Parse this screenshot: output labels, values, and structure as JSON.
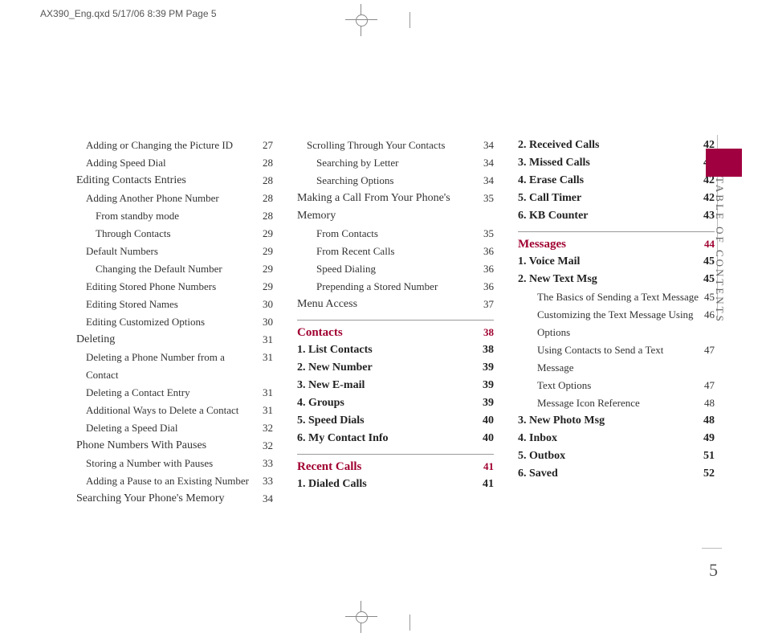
{
  "slug": "AX390_Eng.qxd  5/17/06  8:39 PM  Page 5",
  "sidebar": "TABLE OF CONTENTS",
  "pagenum": "5",
  "col1": [
    {
      "t": "Adding or Changing the Picture ID",
      "p": "27",
      "cls": "i1"
    },
    {
      "t": "Adding Speed Dial",
      "p": "28",
      "cls": "i1"
    },
    {
      "t": "Editing Contacts Entries",
      "p": "28",
      "cls": "l1"
    },
    {
      "t": "Adding Another Phone Number",
      "p": "28",
      "cls": "i1"
    },
    {
      "t": "From standby mode",
      "p": "28",
      "cls": "i2"
    },
    {
      "t": "Through Contacts",
      "p": "29",
      "cls": "i2"
    },
    {
      "t": "Default Numbers",
      "p": "29",
      "cls": "i1"
    },
    {
      "t": "Changing the Default Number",
      "p": "29",
      "cls": "i2"
    },
    {
      "t": "Editing Stored Phone Numbers",
      "p": "29",
      "cls": "i1"
    },
    {
      "t": "Editing Stored Names",
      "p": "30",
      "cls": "i1"
    },
    {
      "t": "Editing Customized Options",
      "p": "30",
      "cls": "i1"
    },
    {
      "t": "Deleting",
      "p": "31",
      "cls": "l1"
    },
    {
      "t": "Deleting a Phone Number from a Contact",
      "p": "31",
      "cls": "i1"
    },
    {
      "t": "Deleting a Contact Entry",
      "p": "31",
      "cls": "i1"
    },
    {
      "t": "Additional Ways to Delete a Contact",
      "p": "31",
      "cls": "i1"
    },
    {
      "t": "Deleting a Speed Dial",
      "p": "32",
      "cls": "i1"
    },
    {
      "t": "Phone Numbers With Pauses",
      "p": "32",
      "cls": "l1"
    },
    {
      "t": "Storing a Number with Pauses",
      "p": "33",
      "cls": "i1"
    },
    {
      "t": "Adding a Pause to an Existing Number",
      "p": "33",
      "cls": "i1"
    },
    {
      "t": "Searching Your Phone's Memory",
      "p": "34",
      "cls": "l1"
    }
  ],
  "col2": [
    {
      "t": "Scrolling Through Your Contacts",
      "p": "34",
      "cls": "i1"
    },
    {
      "t": "Searching by Letter",
      "p": "34",
      "cls": "i2"
    },
    {
      "t": "Searching Options",
      "p": "34",
      "cls": "i2"
    },
    {
      "t": "Making a Call From Your Phone's Memory",
      "p": "35",
      "cls": "l1"
    },
    {
      "t": "From Contacts",
      "p": "35",
      "cls": "i2"
    },
    {
      "t": "From Recent Calls",
      "p": "36",
      "cls": "i2"
    },
    {
      "t": "Speed Dialing",
      "p": "36",
      "cls": "i2"
    },
    {
      "t": "Prepending a Stored Number",
      "p": "36",
      "cls": "i2"
    },
    {
      "t": "Menu Access",
      "p": "37",
      "cls": "l1"
    },
    {
      "hr": true
    },
    {
      "t": "Contacts",
      "p": "38",
      "sec": true
    },
    {
      "t": "1. List Contacts",
      "p": "38",
      "cls": "bold"
    },
    {
      "t": "2. New Number",
      "p": "39",
      "cls": "bold"
    },
    {
      "t": "3. New E-mail",
      "p": "39",
      "cls": "bold"
    },
    {
      "t": "4. Groups",
      "p": "39",
      "cls": "bold"
    },
    {
      "t": "5. Speed Dials",
      "p": "40",
      "cls": "bold"
    },
    {
      "t": "6. My Contact Info",
      "p": "40",
      "cls": "bold"
    },
    {
      "hr": true
    },
    {
      "t": "Recent Calls",
      "p": "41",
      "sec": true
    },
    {
      "t": "1. Dialed Calls",
      "p": "41",
      "cls": "bold"
    }
  ],
  "col3": [
    {
      "t": "2. Received Calls",
      "p": "42",
      "cls": "bold"
    },
    {
      "t": "3. Missed Calls",
      "p": "42",
      "cls": "bold"
    },
    {
      "t": "4. Erase Calls",
      "p": "42",
      "cls": "bold"
    },
    {
      "t": "5. Call Timer",
      "p": "42",
      "cls": "bold"
    },
    {
      "t": "6. KB Counter",
      "p": "43",
      "cls": "bold"
    },
    {
      "hr": true
    },
    {
      "t": "Messages",
      "p": "44",
      "sec": true
    },
    {
      "t": "1. Voice Mail",
      "p": "45",
      "cls": "bold"
    },
    {
      "t": "2. New Text Msg",
      "p": "45",
      "cls": "bold"
    },
    {
      "t": "The Basics of Sending a Text Message",
      "p": "45",
      "cls": "i2"
    },
    {
      "t": "Customizing the Text Message Using Options",
      "p": "46",
      "cls": "i2"
    },
    {
      "t": "Using Contacts to Send a Text Message",
      "p": "47",
      "cls": "i2"
    },
    {
      "t": "Text Options",
      "p": "47",
      "cls": "i2"
    },
    {
      "t": "Message Icon Reference",
      "p": "48",
      "cls": "i2"
    },
    {
      "t": "3. New Photo Msg",
      "p": "48",
      "cls": "bold"
    },
    {
      "t": "4. Inbox",
      "p": "49",
      "cls": "bold"
    },
    {
      "t": "5. Outbox",
      "p": "51",
      "cls": "bold"
    },
    {
      "t": "6. Saved",
      "p": "52",
      "cls": "bold"
    }
  ]
}
